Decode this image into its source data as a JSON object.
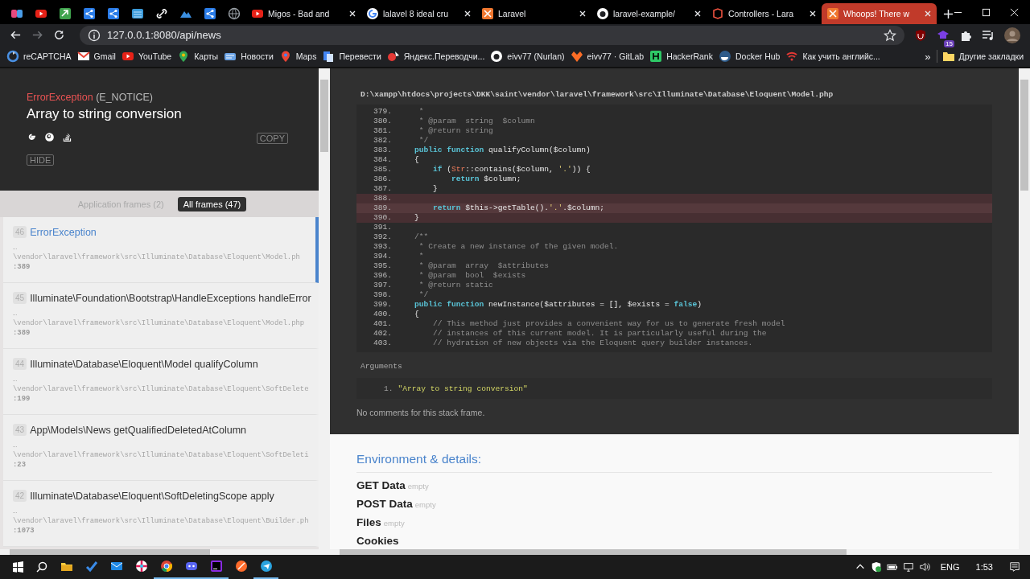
{
  "browser": {
    "tabs": [
      {
        "selected": false
      },
      {
        "selected": false
      },
      {
        "selected": false
      },
      {
        "selected": false
      },
      {
        "selected": false
      },
      {
        "selected": false
      },
      {
        "selected": false
      },
      {
        "selected": false
      },
      {
        "selected": false
      },
      {
        "selected": false
      },
      {
        "title": "Migos - Bad and",
        "selected": false
      },
      {
        "title": "lalavel 8 ideal cru",
        "selected": false
      },
      {
        "title": "Laravel",
        "selected": false
      },
      {
        "title": "laravel-example/",
        "selected": false
      },
      {
        "title": "Controllers - Lara",
        "selected": false
      },
      {
        "title": "Whoops! There w",
        "selected": true
      }
    ],
    "url": "127.0.0.1:8080/api/news",
    "extension_badge": "15",
    "bookmarks": [
      {
        "label": "reCAPTCHA"
      },
      {
        "label": "Gmail"
      },
      {
        "label": "YouTube"
      },
      {
        "label": "Карты"
      },
      {
        "label": "Новости"
      },
      {
        "label": "Maps"
      },
      {
        "label": "Перевести"
      },
      {
        "label": "Яндекс.Переводчи..."
      },
      {
        "label": "eivv77 (Nurlan)"
      },
      {
        "label": "eivv77 · GitLab"
      },
      {
        "label": "HackerRank"
      },
      {
        "label": "Docker Hub"
      },
      {
        "label": "Как учить английс..."
      }
    ],
    "bookmarks_more": "»",
    "other_bookmarks": "Другие закладки"
  },
  "exception": {
    "class": "ErrorException",
    "code": "(E_NOTICE)",
    "message": "Array to string conversion",
    "copy_button": "COPY",
    "hide_button": "HIDE"
  },
  "frame_tabs": [
    {
      "label": "Application frames (2)",
      "selected": false
    },
    {
      "label": "All frames (47)",
      "selected": true
    }
  ],
  "frames": [
    {
      "index": "46",
      "title": "ErrorException",
      "selected": true,
      "ellipsis": "…",
      "file": "\\vendor\\laravel\\framework\\src\\Illuminate\\Database\\Eloquent\\Model.ph",
      "line": ":389"
    },
    {
      "index": "45",
      "title": "Illuminate\\Foundation\\Bootstrap\\HandleExceptions handleError",
      "selected": false,
      "ellipsis": "…",
      "file": "\\vendor\\laravel\\framework\\src\\Illuminate\\Database\\Eloquent\\Model.php",
      "line": ":389"
    },
    {
      "index": "44",
      "title": "Illuminate\\Database\\Eloquent\\Model qualifyColumn",
      "selected": false,
      "ellipsis": "…",
      "file": "\\vendor\\laravel\\framework\\src\\Illuminate\\Database\\Eloquent\\SoftDelete",
      "line": ":199"
    },
    {
      "index": "43",
      "title": "App\\Models\\News getQualifiedDeletedAtColumn",
      "selected": false,
      "ellipsis": "…",
      "file": "\\vendor\\laravel\\framework\\src\\Illuminate\\Database\\Eloquent\\SoftDeleti",
      "line": ":23"
    },
    {
      "index": "42",
      "title": "Illuminate\\Database\\Eloquent\\SoftDeletingScope apply",
      "selected": false,
      "ellipsis": "…",
      "file": "\\vendor\\laravel\\framework\\src\\Illuminate\\Database\\Eloquent\\Builder.ph",
      "line": ":1073"
    }
  ],
  "code": {
    "file": "D:\\xampp\\htdocs\\projects\\DKK\\saint\\vendor\\laravel\\framework\\src\\Illuminate\\Database\\Eloquent\\Model.php",
    "lines": [
      {
        "n": "379.",
        "selected": false,
        "highlighted": false,
        "tokens": [
          {
            "kind": "comment",
            "t": " *"
          }
        ]
      },
      {
        "n": "380.",
        "selected": false,
        "highlighted": false,
        "tokens": [
          {
            "kind": "comment",
            "t": " * @param  string  $column"
          }
        ]
      },
      {
        "n": "381.",
        "selected": false,
        "highlighted": false,
        "tokens": [
          {
            "kind": "comment",
            "t": " * @return string"
          }
        ]
      },
      {
        "n": "382.",
        "selected": false,
        "highlighted": false,
        "tokens": [
          {
            "kind": "comment",
            "t": " */"
          }
        ]
      },
      {
        "n": "383.",
        "selected": false,
        "highlighted": false,
        "tokens": [
          {
            "kind": "keyword",
            "t": "public function"
          },
          {
            "kind": "plain",
            "t": " qualifyColumn($column)"
          }
        ]
      },
      {
        "n": "384.",
        "selected": false,
        "highlighted": false,
        "tokens": [
          {
            "kind": "plain",
            "t": "{"
          }
        ]
      },
      {
        "n": "385.",
        "selected": false,
        "highlighted": false,
        "tokens": [
          {
            "kind": "keyword",
            "t": "    if"
          },
          {
            "kind": "plain",
            "t": " ("
          },
          {
            "kind": "class",
            "t": "Str"
          },
          {
            "kind": "plain",
            "t": "::contains($column, "
          },
          {
            "kind": "string",
            "t": "'.'"
          },
          {
            "kind": "plain",
            "t": ")) {"
          }
        ]
      },
      {
        "n": "386.",
        "selected": false,
        "highlighted": false,
        "tokens": [
          {
            "kind": "keyword",
            "t": "        return"
          },
          {
            "kind": "plain",
            "t": " $column;"
          }
        ]
      },
      {
        "n": "387.",
        "selected": false,
        "highlighted": false,
        "tokens": [
          {
            "kind": "plain",
            "t": "    }"
          }
        ]
      },
      {
        "n": "388.",
        "selected": false,
        "highlighted": true
      },
      {
        "n": "389.",
        "selected": true,
        "highlighted": true,
        "tokens": [
          {
            "kind": "keyword",
            "t": "    return"
          },
          {
            "kind": "plain",
            "t": " $this->getTable()."
          },
          {
            "kind": "string",
            "t": "'.'"
          },
          {
            "kind": "plain",
            "t": ".$column;"
          }
        ]
      },
      {
        "n": "390.",
        "selected": false,
        "highlighted": true,
        "tokens": [
          {
            "kind": "plain",
            "t": "}"
          }
        ]
      },
      {
        "n": "391.",
        "selected": false,
        "highlighted": false
      },
      {
        "n": "392.",
        "selected": false,
        "highlighted": false,
        "tokens": [
          {
            "kind": "comment",
            "t": "/**"
          }
        ]
      },
      {
        "n": "393.",
        "selected": false,
        "highlighted": false,
        "tokens": [
          {
            "kind": "comment",
            "t": " * Create a new instance of the given model."
          }
        ]
      },
      {
        "n": "394.",
        "selected": false,
        "highlighted": false,
        "tokens": [
          {
            "kind": "comment",
            "t": " *"
          }
        ]
      },
      {
        "n": "395.",
        "selected": false,
        "highlighted": false,
        "tokens": [
          {
            "kind": "comment",
            "t": " * @param  array  $attributes"
          }
        ]
      },
      {
        "n": "396.",
        "selected": false,
        "highlighted": false,
        "tokens": [
          {
            "kind": "comment",
            "t": " * @param  bool  $exists"
          }
        ]
      },
      {
        "n": "397.",
        "selected": false,
        "highlighted": false,
        "tokens": [
          {
            "kind": "comment",
            "t": " * @return static"
          }
        ]
      },
      {
        "n": "398.",
        "selected": false,
        "highlighted": false,
        "tokens": [
          {
            "kind": "comment",
            "t": " */"
          }
        ]
      },
      {
        "n": "399.",
        "selected": false,
        "highlighted": false,
        "tokens": [
          {
            "kind": "keyword",
            "t": "public function"
          },
          {
            "kind": "plain",
            "t": " newInstance($attributes = [], $exists = "
          },
          {
            "kind": "keyword",
            "t": "false"
          },
          {
            "kind": "plain",
            "t": ")"
          }
        ]
      },
      {
        "n": "400.",
        "selected": false,
        "highlighted": false,
        "tokens": [
          {
            "kind": "plain",
            "t": "{"
          }
        ]
      },
      {
        "n": "401.",
        "selected": false,
        "highlighted": false,
        "tokens": [
          {
            "kind": "comment",
            "t": "    // This method just provides a convenient way for us to generate fresh model"
          }
        ]
      },
      {
        "n": "402.",
        "selected": false,
        "highlighted": false,
        "tokens": [
          {
            "kind": "comment",
            "t": "    // instances of this current model. It is particularly useful during the"
          }
        ]
      },
      {
        "n": "403.",
        "selected": false,
        "highlighted": false,
        "tokens": [
          {
            "kind": "comment",
            "t": "    // hydration of new objects via the Eloquent query builder instances."
          }
        ]
      }
    ]
  },
  "arguments": {
    "label": "Arguments",
    "items": [
      {
        "n": "1.",
        "value": "\"Array to string conversion\""
      }
    ]
  },
  "comments": "No comments for this stack frame.",
  "environment": {
    "title": "Environment & details:",
    "sections": [
      {
        "name": "GET Data",
        "note": "empty"
      },
      {
        "name": "POST Data",
        "note": "empty"
      },
      {
        "name": "Files",
        "note": "empty"
      },
      {
        "name": "Cookies"
      }
    ]
  },
  "taskbar": {
    "apps": [
      {
        "running": false
      },
      {
        "running": false
      },
      {
        "running": false
      },
      {
        "running": false
      },
      {
        "running": true
      },
      {
        "running": true
      },
      {
        "running": true
      },
      {
        "running": false
      },
      {
        "running": true
      }
    ],
    "language": "ENG",
    "time": "1:53"
  }
}
